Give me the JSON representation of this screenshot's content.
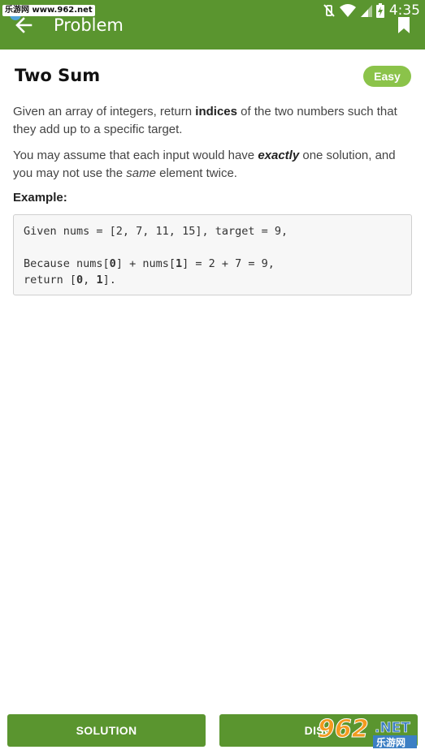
{
  "status_bar": {
    "watermark": "乐游网 www.962.net",
    "time": "4:35"
  },
  "app_bar": {
    "title": "Problem"
  },
  "problem": {
    "title": "Two Sum",
    "difficulty": "Easy",
    "p1_before": "Given an array of integers, return ",
    "p1_bold": "indices",
    "p1_after": " of the two numbers such that they add up to a specific target.",
    "p2_before": "You may assume that each input would have ",
    "p2_bolditalic": "exactly",
    "p2_middle": " one solution, and you may not use the ",
    "p2_italic": "same",
    "p2_after": " element twice.",
    "example_label": "Example:",
    "code": {
      "line1": "Given nums = [2, 7, 11, 15], target = 9,",
      "line2_a": "Because nums[",
      "line2_b": "0",
      "line2_c": "] + nums[",
      "line2_d": "1",
      "line2_e": "] = 2 + 7 = 9,",
      "line3_a": "return [",
      "line3_b": "0",
      "line3_c": ", ",
      "line3_d": "1",
      "line3_e": "]."
    }
  },
  "buttons": {
    "solution": "SOLUTION",
    "discuss": "DISC"
  },
  "corner_watermark": {
    "brand": "962",
    "suffix": ".NET",
    "sub": "乐游网"
  },
  "colors": {
    "app_bar": "#5a952f",
    "badge": "#8bc34a"
  }
}
